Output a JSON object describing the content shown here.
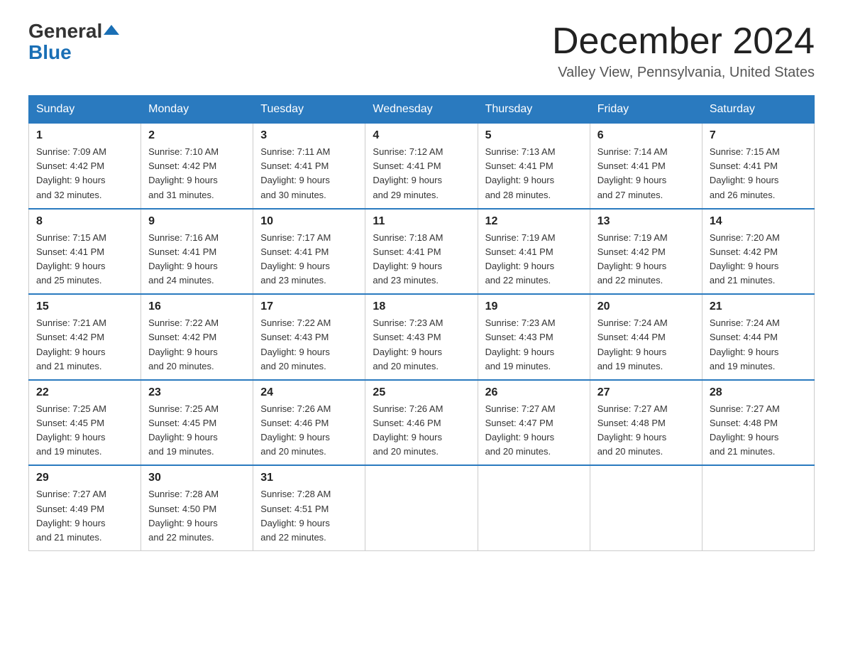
{
  "header": {
    "logo_general": "General",
    "logo_blue": "Blue",
    "month_title": "December 2024",
    "location": "Valley View, Pennsylvania, United States"
  },
  "weekdays": [
    "Sunday",
    "Monday",
    "Tuesday",
    "Wednesday",
    "Thursday",
    "Friday",
    "Saturday"
  ],
  "weeks": [
    [
      {
        "day": "1",
        "sunrise": "7:09 AM",
        "sunset": "4:42 PM",
        "daylight": "9 hours and 32 minutes."
      },
      {
        "day": "2",
        "sunrise": "7:10 AM",
        "sunset": "4:42 PM",
        "daylight": "9 hours and 31 minutes."
      },
      {
        "day": "3",
        "sunrise": "7:11 AM",
        "sunset": "4:41 PM",
        "daylight": "9 hours and 30 minutes."
      },
      {
        "day": "4",
        "sunrise": "7:12 AM",
        "sunset": "4:41 PM",
        "daylight": "9 hours and 29 minutes."
      },
      {
        "day": "5",
        "sunrise": "7:13 AM",
        "sunset": "4:41 PM",
        "daylight": "9 hours and 28 minutes."
      },
      {
        "day": "6",
        "sunrise": "7:14 AM",
        "sunset": "4:41 PM",
        "daylight": "9 hours and 27 minutes."
      },
      {
        "day": "7",
        "sunrise": "7:15 AM",
        "sunset": "4:41 PM",
        "daylight": "9 hours and 26 minutes."
      }
    ],
    [
      {
        "day": "8",
        "sunrise": "7:15 AM",
        "sunset": "4:41 PM",
        "daylight": "9 hours and 25 minutes."
      },
      {
        "day": "9",
        "sunrise": "7:16 AM",
        "sunset": "4:41 PM",
        "daylight": "9 hours and 24 minutes."
      },
      {
        "day": "10",
        "sunrise": "7:17 AM",
        "sunset": "4:41 PM",
        "daylight": "9 hours and 23 minutes."
      },
      {
        "day": "11",
        "sunrise": "7:18 AM",
        "sunset": "4:41 PM",
        "daylight": "9 hours and 23 minutes."
      },
      {
        "day": "12",
        "sunrise": "7:19 AM",
        "sunset": "4:41 PM",
        "daylight": "9 hours and 22 minutes."
      },
      {
        "day": "13",
        "sunrise": "7:19 AM",
        "sunset": "4:42 PM",
        "daylight": "9 hours and 22 minutes."
      },
      {
        "day": "14",
        "sunrise": "7:20 AM",
        "sunset": "4:42 PM",
        "daylight": "9 hours and 21 minutes."
      }
    ],
    [
      {
        "day": "15",
        "sunrise": "7:21 AM",
        "sunset": "4:42 PM",
        "daylight": "9 hours and 21 minutes."
      },
      {
        "day": "16",
        "sunrise": "7:22 AM",
        "sunset": "4:42 PM",
        "daylight": "9 hours and 20 minutes."
      },
      {
        "day": "17",
        "sunrise": "7:22 AM",
        "sunset": "4:43 PM",
        "daylight": "9 hours and 20 minutes."
      },
      {
        "day": "18",
        "sunrise": "7:23 AM",
        "sunset": "4:43 PM",
        "daylight": "9 hours and 20 minutes."
      },
      {
        "day": "19",
        "sunrise": "7:23 AM",
        "sunset": "4:43 PM",
        "daylight": "9 hours and 19 minutes."
      },
      {
        "day": "20",
        "sunrise": "7:24 AM",
        "sunset": "4:44 PM",
        "daylight": "9 hours and 19 minutes."
      },
      {
        "day": "21",
        "sunrise": "7:24 AM",
        "sunset": "4:44 PM",
        "daylight": "9 hours and 19 minutes."
      }
    ],
    [
      {
        "day": "22",
        "sunrise": "7:25 AM",
        "sunset": "4:45 PM",
        "daylight": "9 hours and 19 minutes."
      },
      {
        "day": "23",
        "sunrise": "7:25 AM",
        "sunset": "4:45 PM",
        "daylight": "9 hours and 19 minutes."
      },
      {
        "day": "24",
        "sunrise": "7:26 AM",
        "sunset": "4:46 PM",
        "daylight": "9 hours and 20 minutes."
      },
      {
        "day": "25",
        "sunrise": "7:26 AM",
        "sunset": "4:46 PM",
        "daylight": "9 hours and 20 minutes."
      },
      {
        "day": "26",
        "sunrise": "7:27 AM",
        "sunset": "4:47 PM",
        "daylight": "9 hours and 20 minutes."
      },
      {
        "day": "27",
        "sunrise": "7:27 AM",
        "sunset": "4:48 PM",
        "daylight": "9 hours and 20 minutes."
      },
      {
        "day": "28",
        "sunrise": "7:27 AM",
        "sunset": "4:48 PM",
        "daylight": "9 hours and 21 minutes."
      }
    ],
    [
      {
        "day": "29",
        "sunrise": "7:27 AM",
        "sunset": "4:49 PM",
        "daylight": "9 hours and 21 minutes."
      },
      {
        "day": "30",
        "sunrise": "7:28 AM",
        "sunset": "4:50 PM",
        "daylight": "9 hours and 22 minutes."
      },
      {
        "day": "31",
        "sunrise": "7:28 AM",
        "sunset": "4:51 PM",
        "daylight": "9 hours and 22 minutes."
      },
      null,
      null,
      null,
      null
    ]
  ],
  "labels": {
    "sunrise": "Sunrise:",
    "sunset": "Sunset:",
    "daylight": "Daylight:"
  }
}
